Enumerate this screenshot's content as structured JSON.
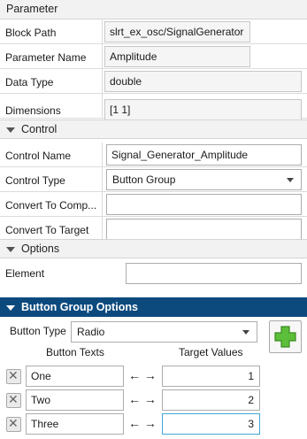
{
  "sections": {
    "parameter": "Parameter",
    "control": "Control",
    "options": "Options",
    "button_group_options": "Button Group Options"
  },
  "parameter": {
    "block_path_label": "Block Path",
    "block_path_value": "slrt_ex_osc/SignalGenerator",
    "parameter_name_label": "Parameter Name",
    "parameter_name_value": "Amplitude",
    "data_type_label": "Data Type",
    "data_type_value": "double",
    "dimensions_label": "Dimensions",
    "dimensions_value": "[1 1]"
  },
  "control": {
    "control_name_label": "Control Name",
    "control_name_value": "Signal_Generator_Amplitude",
    "control_type_label": "Control Type",
    "control_type_value": "Button Group",
    "convert_to_comp_label": "Convert To Comp...",
    "convert_to_comp_value": "",
    "convert_to_target_label": "Convert To Target",
    "convert_to_target_value": ""
  },
  "options": {
    "element_label": "Element",
    "element_value": ""
  },
  "button_group": {
    "button_type_label": "Button Type",
    "button_type_value": "Radio",
    "button_texts_header": "Button Texts",
    "target_values_header": "Target Values",
    "arrow_glyph": "← →",
    "rows": [
      {
        "text": "One",
        "value": "1"
      },
      {
        "text": "Two",
        "value": "2"
      },
      {
        "text": "Three",
        "value": "3"
      }
    ]
  },
  "colors": {
    "header_dark": "#0c4a7e",
    "add_icon": "#4cae2e",
    "focus_border": "#41a6d9"
  }
}
